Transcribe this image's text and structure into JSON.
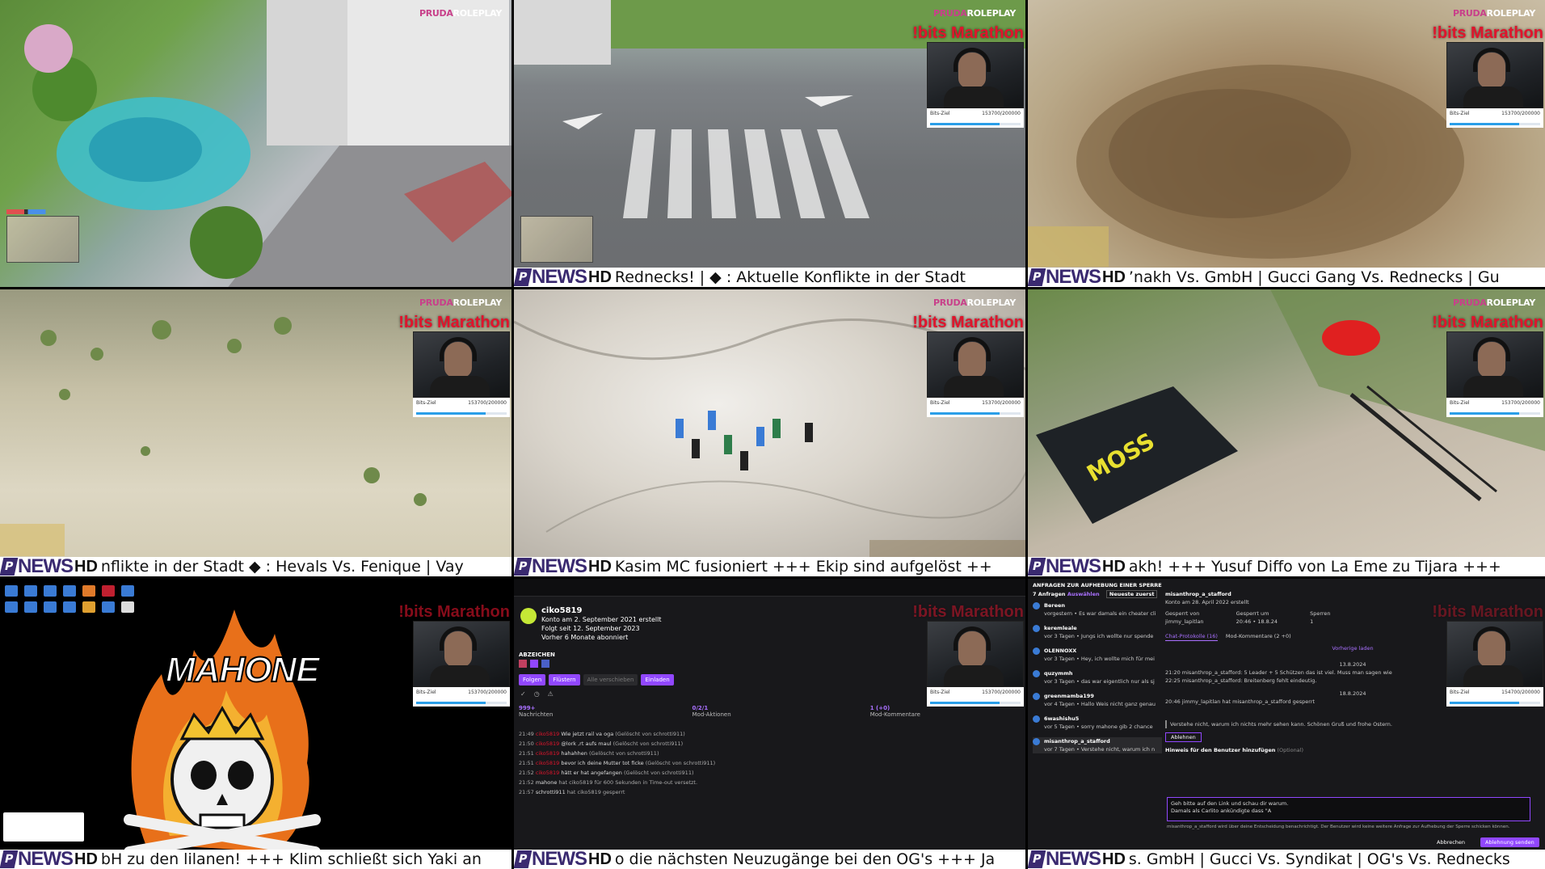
{
  "brand": {
    "name_a": "PRUDA",
    "name_b": "ROLEPLAY"
  },
  "overlay": {
    "marathon": "!bits  Marathon",
    "goal_label": "Bits-Ziel",
    "goal_value": "153700/200000",
    "goal_value_alt": "154700/200000",
    "goal_progress": 0.77
  },
  "news": {
    "mark": "P",
    "news": "NEWS",
    "hd": "HD"
  },
  "tickers": [
    "",
    "Rednecks!  |  ◆ : Aktuelle Konflikte in der Stadt",
    "’nakh Vs. GmbH | Gucci Gang Vs. Rednecks | Gu",
    "nflikte in der Stadt  ◆ : Hevals Vs. Fenique | Vay",
    "Kasim MC fusioniert +++ Ekip sind aufgelöst ++",
    "akh! +++ Yusuf Diffo von La Eme zu Tijara +++",
    "bH zu den lilanen! +++ Klim schließt sich Yaki an",
    "o die nächsten Neuzugänge bei den OG's +++ Ja",
    "s. GmbH | Gucci Vs. Syndikat | OG's Vs. Rednecks"
  ],
  "desktop": {
    "logo_text": "MAHONE"
  },
  "twitch": {
    "username": "ciko5819",
    "created": "Konto am 2. September 2021 erstellt",
    "followed": "Folgt seit 12. September 2023",
    "subscribed": "Vorher 6 Monate abonniert",
    "badges_label": "ABZEICHEN",
    "buttons": [
      "Folgen",
      "Flüstern",
      "Alle verschieben",
      "Einladen"
    ],
    "stats": [
      {
        "num": "999+",
        "label": "Nachrichten"
      },
      {
        "num": "0/2/1",
        "label": "Mod-Aktionen"
      },
      {
        "num": "1 (+0)",
        "label": "Mod-Kommentare"
      }
    ],
    "messages": [
      {
        "time": "21:49",
        "user": "ciko5819",
        "text": "Wie jetzt rail va oga",
        "note": "(Gelöscht von schrotti911)"
      },
      {
        "time": "21:50",
        "user": "ciko5819",
        "text": "@lork ,rt aufs maul",
        "note": "(Gelöscht von schrotti911)"
      },
      {
        "time": "21:51",
        "user": "ciko5819",
        "text": "hahahhen",
        "note": "(Gelöscht von schrotti911)"
      },
      {
        "time": "21:51",
        "user": "ciko5819",
        "text": "bevor ich deine Mutter tot ficke",
        "note": "(Gelöscht von schrotti911)"
      },
      {
        "time": "21:52",
        "user": "ciko5819",
        "text": "hätt er hat angefangen",
        "note": "(Gelöscht von schrotti911)"
      },
      {
        "time": "21:52",
        "user": "mahone",
        "text": "hat ciko5819 für 600 Sekunden in Time-out versetzt.",
        "note": ""
      },
      {
        "time": "21:57",
        "user": "schrotti911",
        "text": "hat ciko5819 gesperrt",
        "note": ""
      }
    ]
  },
  "mod": {
    "header": "ANFRAGEN ZUR AUFHEBUNG EINER SPERRE",
    "count": "7 Anfragen",
    "select": "Auswählen",
    "sort": "Neueste zuerst",
    "requests": [
      {
        "user": "Bereen",
        "meta": "vorgestern",
        "text": "Es war damals ein cheater cli"
      },
      {
        "user": "keremleale",
        "meta": "vor 3 Tagen",
        "text": "Jungs ich wollte nur spende"
      },
      {
        "user": "OLENNOXX",
        "meta": "vor 3 Tagen",
        "text": "Hey, ich wollte mich für mei"
      },
      {
        "user": "quzymmh",
        "meta": "vor 3 Tagen",
        "text": "das war eigentlich nur als sj"
      },
      {
        "user": "greenmamba199",
        "meta": "vor 4 Tagen",
        "text": "Hallo Weis nicht ganz genau"
      },
      {
        "user": "6washishu5",
        "meta": "vor 5 Tagen",
        "text": "sorry mahone gib 2 chance"
      },
      {
        "user": "misanthrop_a_stafford",
        "meta": "vor 7 Tagen",
        "text": "Verstehe nicht, warum ich n"
      }
    ],
    "selected_user": "misanthrop_a_stafford",
    "selected_created": "Konto am 28. April 2022 erstellt",
    "banned_by_label": "Gesperrt von",
    "banned_by": "jimmy_lapitlan",
    "banned_at_label": "Gesperrt um",
    "banned_at": "20:46 • 18.8.24",
    "bans_label": "Sperren",
    "bans": "1",
    "tabs": [
      "Chat-Protokolle (16)",
      "Mod-Kommentare (2 +0)"
    ],
    "prev": "Vorherige laden",
    "date1": "13.8.2024",
    "log1": "21:20  misanthrop_a_stafford: 5 Leader + 5 Schützen das ist viel. Muss man sagen wie",
    "log2": "22:25  misanthrop_a_stafford: Breitenberg fehlt eindeutig.",
    "date2": "18.8.2024",
    "log3": "20:46  jimmy_lapitlan hat misanthrop_a_stafford gesperrt",
    "appeal": "Verstehe nicht, warum ich nichts mehr sehen kann. Schönen Gruß und frohe Ostern.",
    "reject": "Ablehnen",
    "hint": "Hinweis für den Benutzer hinzufügen",
    "optional": "(Optional)",
    "reply": "Geh bitte auf den Link und schau dir warum. Damals als Carlito ankündigte dass \"A",
    "notice": "misanthrop_a_stafford wird über deine Entscheidung benachrichtigt. Der Benutzer wird keine weitere Anfrage zur Aufhebung der Sperre schicken können.",
    "cancel": "Abbrechen",
    "send": "Ablehnung senden"
  },
  "colors": {
    "accent": "#9147ff",
    "marathon": "#e0142c",
    "news": "#3a2a70"
  }
}
